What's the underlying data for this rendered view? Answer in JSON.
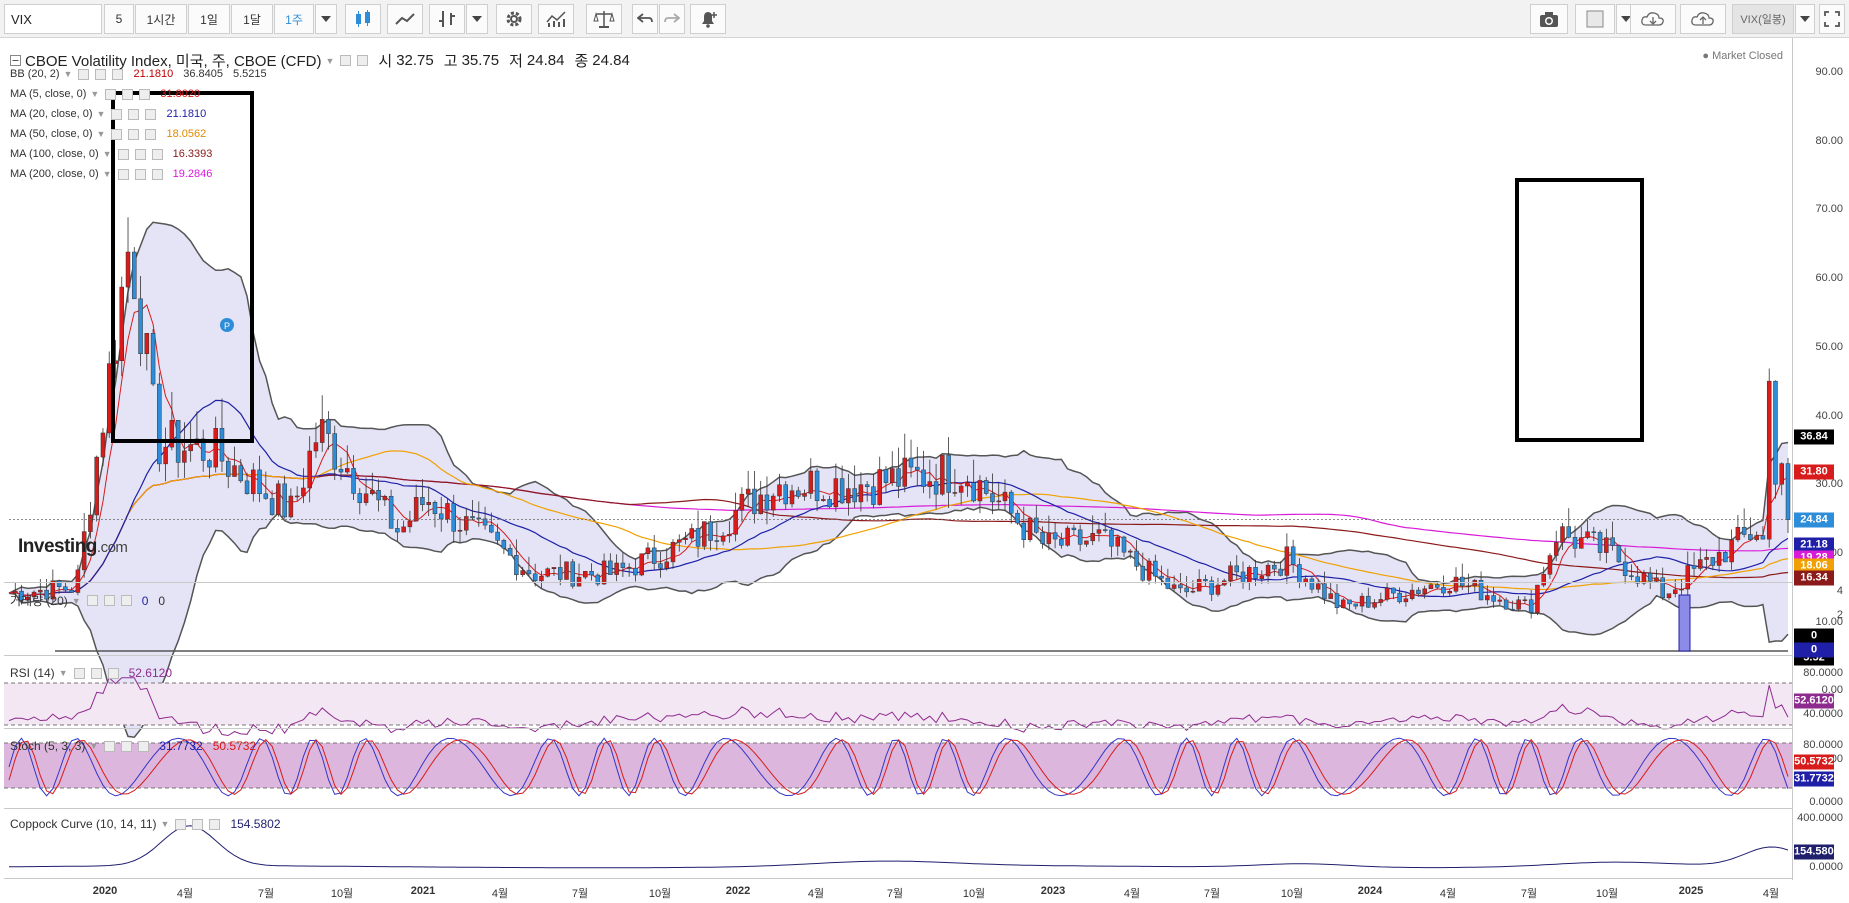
{
  "toolbar": {
    "symbol": "VIX",
    "intervals": [
      "5",
      "1시간",
      "1일",
      "1달",
      "1주"
    ],
    "active_interval": "1주",
    "right_label": "VIX(일봉)"
  },
  "main": {
    "title": "CBOE Volatility Index, 미국, 주, CBOE (CFD)",
    "ohlc": {
      "open_label": "시",
      "open": "32.75",
      "high_label": "고",
      "high": "35.75",
      "low_label": "저",
      "low": "24.84",
      "close_label": "종",
      "close": "24.84"
    },
    "market_status": "Market Closed",
    "logo": {
      "main": "Investing",
      "suffix": ".com"
    },
    "indicators": [
      {
        "label": "BB (20, 2)",
        "values": [
          "21.1810",
          "36.8405",
          "5.5215"
        ],
        "color": "#c00000"
      },
      {
        "label": "MA (5, close, 0)",
        "values": [
          "31.8020"
        ],
        "color": "#d81b1b"
      },
      {
        "label": "MA (20, close, 0)",
        "values": [
          "21.1810"
        ],
        "color": "#1f1fa8"
      },
      {
        "label": "MA (50, close, 0)",
        "values": [
          "18.0562"
        ],
        "color": "#e08a00"
      },
      {
        "label": "MA (100, close, 0)",
        "values": [
          "16.3393"
        ],
        "color": "#8b1a1a"
      },
      {
        "label": "MA (200, close, 0)",
        "values": [
          "19.2846"
        ],
        "color": "#d81bd8"
      }
    ],
    "y_ticks": [
      "90.00",
      "80.00",
      "70.00",
      "60.00",
      "50.00",
      "40.00",
      "30.00",
      "20.00",
      "10.00",
      "0.00",
      "-10.00"
    ],
    "badges": [
      {
        "text": "36.84",
        "color": "#000000"
      },
      {
        "text": "31.80",
        "color": "#d81b1b"
      },
      {
        "text": "24.84",
        "color": "#2e8dd8"
      },
      {
        "text": "21.18",
        "color": "#1f1fa8"
      },
      {
        "text": "19.28",
        "color": "#d81bd8"
      },
      {
        "text": "18.06",
        "color": "#f0a000"
      },
      {
        "text": "16.34",
        "color": "#8b1a1a"
      },
      {
        "text": "5.52",
        "color": "#000000"
      }
    ],
    "event_marker": "P"
  },
  "volume": {
    "label": "거래량 (20)",
    "values": [
      "0",
      "0"
    ],
    "y_ticks": [
      "4",
      "2"
    ],
    "badges": [
      {
        "text": "0",
        "color": "#000000"
      },
      {
        "text": "0",
        "color": "#1f1fa8"
      }
    ]
  },
  "rsi": {
    "label": "RSI (14)",
    "value": "52.6120",
    "y_ticks": [
      "80.0000",
      "40.0000"
    ],
    "badge": "52.6120"
  },
  "stoch": {
    "label": "Stoch (5, 3, 3)",
    "values": [
      "31.7732",
      "50.5732"
    ],
    "y_ticks": [
      "80.0000",
      "0.0000"
    ],
    "badges": [
      {
        "text": "50.5732",
        "color": "#d81b1b"
      },
      {
        "text": "31.7732",
        "color": "#1f1fa8"
      }
    ]
  },
  "coppock": {
    "label": "Coppock Curve (10, 14, 11)",
    "value": "154.5802",
    "y_ticks": [
      "400.0000",
      "0.0000"
    ],
    "badge": "154.5802"
  },
  "x_axis": [
    "2020",
    "4월",
    "7월",
    "10월",
    "2021",
    "4월",
    "7월",
    "10월",
    "2022",
    "4월",
    "7월",
    "10월",
    "2023",
    "4월",
    "7월",
    "10월",
    "2024",
    "4월",
    "7월",
    "10월",
    "2025",
    "4월"
  ],
  "chart_data": {
    "type": "candlestick",
    "title": "CBOE Volatility Index, 미국, 주, CBOE (CFD)",
    "x_range": [
      "2019-10",
      "2025-04"
    ],
    "ylim": [
      -15,
      95
    ],
    "weekly_close_approx": [
      {
        "date": "2019-10",
        "value": 14
      },
      {
        "date": "2020-01",
        "value": 15
      },
      {
        "date": "2020-02",
        "value": 40
      },
      {
        "date": "2020-03",
        "value": 66
      },
      {
        "date": "2020-04",
        "value": 36
      },
      {
        "date": "2020-06",
        "value": 35
      },
      {
        "date": "2020-09",
        "value": 26
      },
      {
        "date": "2020-10",
        "value": 38
      },
      {
        "date": "2021-01",
        "value": 23
      },
      {
        "date": "2021-02",
        "value": 28
      },
      {
        "date": "2021-06",
        "value": 17
      },
      {
        "date": "2021-09",
        "value": 17
      },
      {
        "date": "2021-12",
        "value": 22
      },
      {
        "date": "2022-03",
        "value": 30
      },
      {
        "date": "2022-06",
        "value": 30
      },
      {
        "date": "2022-10",
        "value": 32
      },
      {
        "date": "2023-01",
        "value": 21
      },
      {
        "date": "2023-03",
        "value": 22
      },
      {
        "date": "2023-06",
        "value": 14
      },
      {
        "date": "2023-10",
        "value": 19
      },
      {
        "date": "2023-12",
        "value": 12
      },
      {
        "date": "2024-04",
        "value": 16
      },
      {
        "date": "2024-07",
        "value": 12
      },
      {
        "date": "2024-08",
        "value": 23
      },
      {
        "date": "2024-10",
        "value": 20
      },
      {
        "date": "2024-12",
        "value": 14
      },
      {
        "date": "2025-01",
        "value": 17
      },
      {
        "date": "2025-04",
        "value": 24.84
      }
    ],
    "rsi_range": [
      40,
      80
    ],
    "stoch_range": [
      0,
      80
    ]
  }
}
